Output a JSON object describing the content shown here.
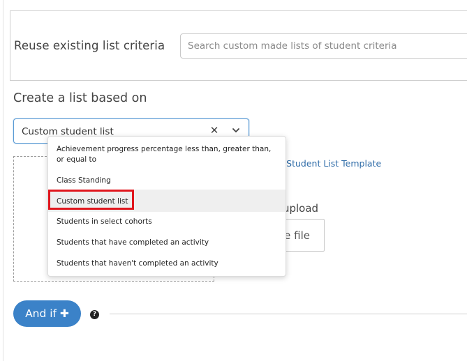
{
  "reuse": {
    "label": "Reuse existing list criteria",
    "search_placeholder": "Search custom made lists of student criteria"
  },
  "create": {
    "label": "Create a list based on",
    "selected_value": "Custom student list",
    "clear_glyph": "✕"
  },
  "dropdown": {
    "options": [
      "Achievement progress percentage less than, greater than, or equal to",
      "Class Standing",
      "Custom student list",
      "Students in select cohorts",
      "Students that have completed an activity",
      "Students that haven't completed an activity"
    ],
    "highlighted_index": 2
  },
  "upload": {
    "template_link": "ustom Student List Template",
    "label": "le to upload",
    "choose_file": "e file"
  },
  "actions": {
    "and_if": "And if ✚",
    "help_glyph": "?"
  },
  "icons": {
    "clear": "close-icon",
    "dropdown": "chevron-down-icon",
    "help": "question-circle-icon"
  },
  "colors": {
    "accent": "#3b82c8",
    "link": "#2f6ca8",
    "highlight": "#e0161d",
    "focus_border": "#5b9bd5"
  }
}
